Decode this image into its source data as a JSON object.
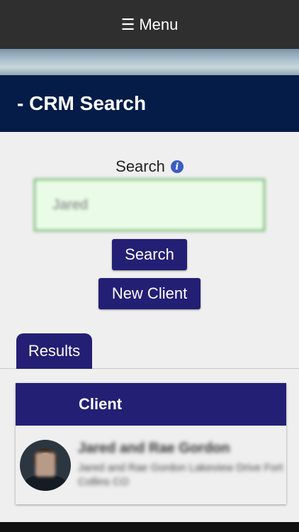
{
  "topbar": {
    "menu_icon": "☰",
    "menu_label": "Menu"
  },
  "title": "- CRM Search",
  "search": {
    "label": "Search",
    "info_icon": "i",
    "value": "Jared"
  },
  "buttons": {
    "search": "Search",
    "new_client": "New Client"
  },
  "tabs": [
    {
      "label": "Results"
    }
  ],
  "results": {
    "column_header": "Client",
    "rows": [
      {
        "name": "Jared and Rae Gordon",
        "detail": "Jared and Rae Gordon Lakeview Drive Fort Collins CO"
      }
    ]
  },
  "colors": {
    "accent": "#231f74",
    "title_bar": "#041c47",
    "top_bar": "#2f2f2f",
    "input_border": "#4ca64c",
    "input_bg": "#eafce8"
  }
}
